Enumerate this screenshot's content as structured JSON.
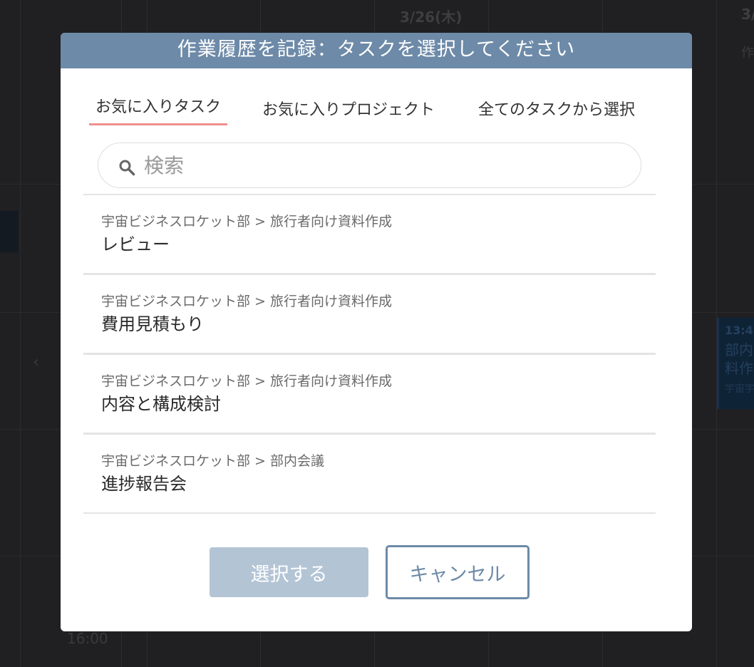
{
  "background": {
    "date_header": "3/26(木)",
    "date_header_right": "3/",
    "time_label": "16:00",
    "right_snippet": "作",
    "event": {
      "time": "13:4",
      "title": "部内料作",
      "subtitle": "宇宙宇宙"
    },
    "nav_prev": "‹"
  },
  "modal": {
    "title": "作業履歴を記録：タスクを選択してください",
    "tabs": [
      {
        "label": "お気に入りタスク",
        "active": true
      },
      {
        "label": "お気に入りプロジェクト",
        "active": false
      },
      {
        "label": "全てのタスクから選択",
        "active": false
      }
    ],
    "search": {
      "placeholder": "検索",
      "value": "",
      "icon": "search-icon"
    },
    "tasks": [
      {
        "path": "宇宙ビジネスロケット部 > 旅行者向け資料作成",
        "name": "レビュー"
      },
      {
        "path": "宇宙ビジネスロケット部 > 旅行者向け資料作成",
        "name": "費用見積もり"
      },
      {
        "path": "宇宙ビジネスロケット部 > 旅行者向け資料作成",
        "name": "内容と構成検討"
      },
      {
        "path": "宇宙ビジネスロケット部 > 部内会議",
        "name": "進捗報告会"
      }
    ],
    "buttons": {
      "select": "選択する",
      "cancel": "キャンセル"
    }
  },
  "colors": {
    "header": "#6d8aa8",
    "select_button_disabled": "#b3c4d5",
    "tab_underline": "#ef8f8f",
    "cancel_border": "#6d8aa8"
  }
}
